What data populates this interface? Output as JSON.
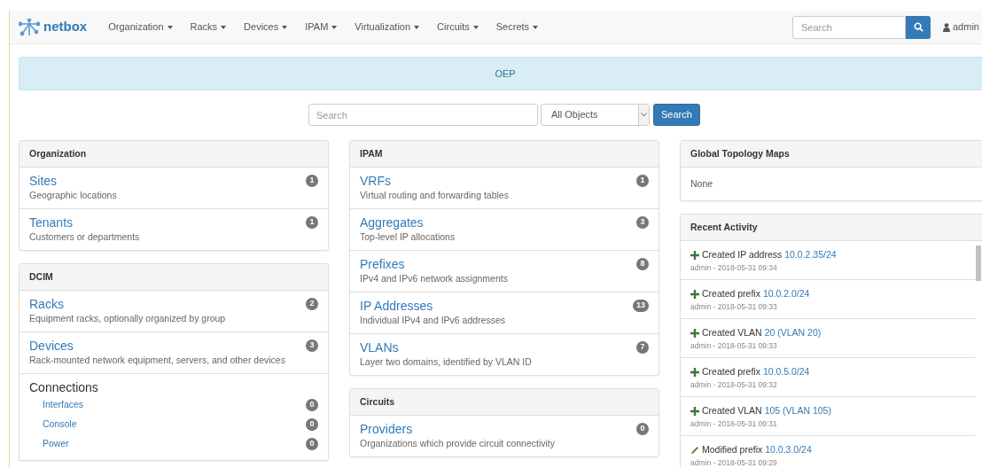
{
  "navbar": {
    "brand": "netbox",
    "menus": [
      "Organization",
      "Racks",
      "Devices",
      "IPAM",
      "Virtualization",
      "Circuits",
      "Secrets"
    ],
    "search": {
      "placeholder": "Search"
    },
    "user": "admin"
  },
  "banner": "OEP",
  "search": {
    "placeholder": "Search",
    "scope": "All Objects",
    "button": "Search"
  },
  "columns": [
    [
      {
        "title": "Organization",
        "kind": "list",
        "items": [
          {
            "kind": "link",
            "label": "Sites",
            "count": "1",
            "description": "Geographic locations"
          },
          {
            "kind": "link",
            "label": "Tenants",
            "count": "1",
            "description": "Customers or departments"
          }
        ]
      },
      {
        "title": "DCIM",
        "kind": "list",
        "items": [
          {
            "kind": "link",
            "label": "Racks",
            "count": "2",
            "description": "Equipment racks, optionally organized by group"
          },
          {
            "kind": "link",
            "label": "Devices",
            "count": "3",
            "description": "Rack-mounted network equipment, servers, and other devices"
          },
          {
            "kind": "group",
            "label": "Connections",
            "children": [
              {
                "label": "Interfaces",
                "count": "0"
              },
              {
                "label": "Console",
                "count": "0"
              },
              {
                "label": "Power",
                "count": "0"
              }
            ]
          }
        ]
      }
    ],
    [
      {
        "title": "IPAM",
        "kind": "list",
        "items": [
          {
            "kind": "link",
            "label": "VRFs",
            "count": "1",
            "description": "Virtual routing and forwarding tables"
          },
          {
            "kind": "link",
            "label": "Aggregates",
            "count": "3",
            "description": "Top-level IP allocations"
          },
          {
            "kind": "link",
            "label": "Prefixes",
            "count": "8",
            "description": "IPv4 and IPv6 network assignments"
          },
          {
            "kind": "link",
            "label": "IP Addresses",
            "count": "13",
            "description": "Individual IPv4 and IPv6 addresses"
          },
          {
            "kind": "link",
            "label": "VLANs",
            "count": "7",
            "description": "Layer two domains, identified by VLAN ID"
          }
        ]
      },
      {
        "title": "Circuits",
        "kind": "list",
        "items": [
          {
            "kind": "link",
            "label": "Providers",
            "count": "0",
            "description": "Organizations which provide circuit connectivity"
          }
        ]
      }
    ],
    [
      {
        "title": "Global Topology Maps",
        "kind": "text",
        "text": "None"
      },
      {
        "title": "Recent Activity",
        "kind": "activity",
        "entries": [
          {
            "kind": "created",
            "action": "Created IP address",
            "object": "10.0.2.35/24",
            "meta": "admin - 2018-05-31 09:34"
          },
          {
            "kind": "created",
            "action": "Created prefix",
            "object": "10.0.2.0/24",
            "meta": "admin - 2018-05-31 09:33"
          },
          {
            "kind": "created",
            "action": "Created VLAN",
            "object": "20 (VLAN 20)",
            "meta": "admin - 2018-05-31 09:33"
          },
          {
            "kind": "created",
            "action": "Created prefix",
            "object": "10.0.5.0/24",
            "meta": "admin - 2018-05-31 09:32"
          },
          {
            "kind": "created",
            "action": "Created VLAN",
            "object": "105 (VLAN 105)",
            "meta": "admin - 2018-05-31 09:31"
          },
          {
            "kind": "modified",
            "action": "Modified prefix",
            "object": "10.0.3.0/24",
            "meta": "admin - 2018-05-31 09:29"
          }
        ]
      }
    ]
  ]
}
